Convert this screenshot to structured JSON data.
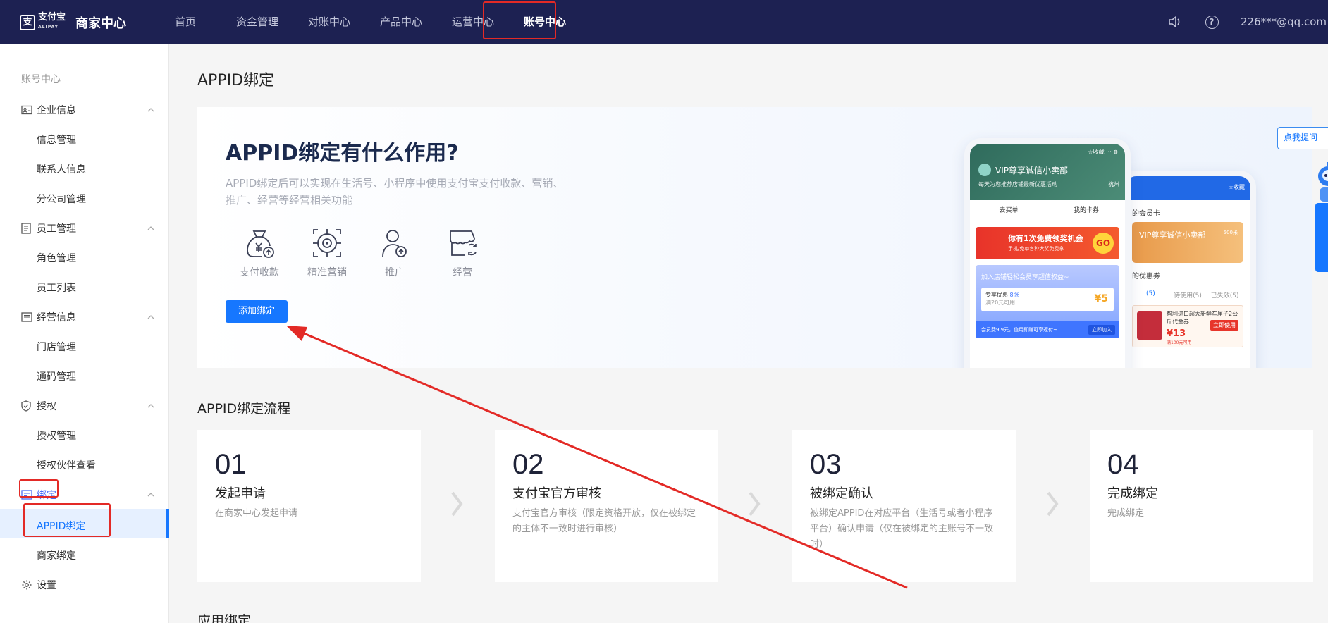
{
  "topbar": {
    "logo_name": "支付宝",
    "logo_sub": "ALIPAY",
    "app_title": "商家中心",
    "nav": [
      "首页",
      "资金管理",
      "对账中心",
      "产品中心",
      "运营中心",
      "账号中心"
    ],
    "active_nav": "账号中心",
    "user_email": "226***@qq.com"
  },
  "sidebar": {
    "title": "账号中心",
    "groups": [
      {
        "label": "企业信息",
        "items": [
          "信息管理",
          "联系人信息",
          "分公司管理"
        ]
      },
      {
        "label": "员工管理",
        "items": [
          "角色管理",
          "员工列表"
        ]
      },
      {
        "label": "经营信息",
        "items": [
          "门店管理",
          "通码管理"
        ]
      },
      {
        "label": "授权",
        "items": [
          "授权管理",
          "授权伙伴查看"
        ]
      },
      {
        "label": "绑定",
        "items": [
          "APPID绑定",
          "商家绑定"
        ]
      },
      {
        "label": "设置",
        "items": []
      }
    ],
    "active_item": "APPID绑定"
  },
  "main": {
    "page_title": "APPID绑定",
    "hero": {
      "title": "APPID绑定有什么作用?",
      "desc": "APPID绑定后可以实现在生活号、小程序中使用支付宝支付收款、营销、推广、经营等经营相关功能",
      "features": [
        "支付收款",
        "精准营销",
        "推广",
        "经营"
      ],
      "button": "添加绑定"
    },
    "phone1": {
      "collect": "☆收藏",
      "store": "VIP尊享诚信小卖部",
      "sub": "每天为您推荐店铺最新优惠活动",
      "city": "杭州",
      "tab1": "去买单",
      "tab2": "我的卡券",
      "banner_title": "你有1次免费领奖机会",
      "banner_sub": "手机/免单各种大奖免费拿",
      "banner_go": "GO",
      "card_title": "加入店铺轻松会员享超值权益~",
      "coupon_label": "专享优惠",
      "coupon_tag": "8张",
      "coupon_cond": "满20元可用",
      "coupon_amount": "¥5",
      "footer": "会员费9.9元，值用即赚可享返付~",
      "join": "立即加入"
    },
    "phone2": {
      "collect": "☆收藏",
      "section1": "的会员卡",
      "card": "VIP尊享诚信小卖部",
      "card_badge": "500米",
      "section2": "的优惠券",
      "tabs": [
        "(5)",
        "待使用(5)",
        "已失效(5)"
      ],
      "coupon_title": "智利进口超大新鲜车厘子2公斤代金券",
      "coupon_amount": "¥13",
      "coupon_cond": "满100元可用",
      "coupon_btn": "立即使用"
    },
    "help_bubble": "点我提问",
    "process_title": "APPID绑定流程",
    "steps": [
      {
        "num": "01",
        "title": "发起申请",
        "desc": "在商家中心发起申请"
      },
      {
        "num": "02",
        "title": "支付宝官方审核",
        "desc": "支付宝官方审核（限定资格开放，仅在被绑定的主体不一致时进行审核）"
      },
      {
        "num": "03",
        "title": "被绑定确认",
        "desc": "被绑定APPID在对应平台（生活号或者小程序平台）确认申请（仅在被绑定的主账号不一致时）"
      },
      {
        "num": "04",
        "title": "完成绑定",
        "desc": "完成绑定"
      }
    ],
    "section2_title": "应用绑定"
  },
  "colors": {
    "topbar_bg": "#1d2152",
    "accent": "#1677ff",
    "annotation": "#e32a26"
  }
}
